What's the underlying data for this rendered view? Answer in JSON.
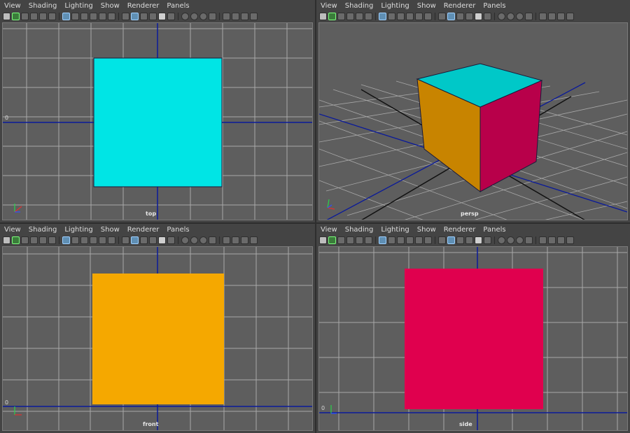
{
  "menu": [
    "View",
    "Shading",
    "Lighting",
    "Show",
    "Renderer",
    "Panels"
  ],
  "panels": {
    "top": {
      "camera": "top",
      "axis_origin": "0",
      "face_color": "#00e5e5"
    },
    "persp": {
      "camera": "persp",
      "top_color": "#00c8c8",
      "front_color": "#c88400",
      "side_color": "#b8004a"
    },
    "front": {
      "camera": "front",
      "axis_origin": "0",
      "face_color": "#f5a800"
    },
    "side": {
      "camera": "side",
      "axis_origin": "0",
      "face_color": "#e0004e"
    }
  },
  "colors": {
    "grid": "#a8a8a8",
    "axis": "#0a1a9a",
    "background": "#5e5e5e"
  }
}
